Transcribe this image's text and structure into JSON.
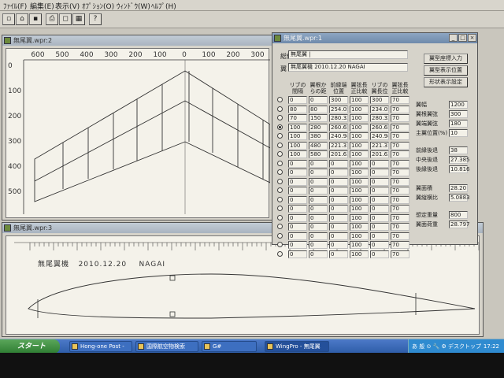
{
  "menu": [
    "ﾌｧｲﾙ(F)",
    "編集(E)",
    "表示(V)",
    "ｵﾌﾟｼｮﾝ(O)",
    "ｳｨﾝﾄﾞｳ(W)",
    "ﾍﾙﾌﾟ(H)"
  ],
  "toolbar_icons": [
    "new-file-icon",
    "open-folder-icon",
    "save-icon",
    "print-icon",
    "view-icon",
    "grid-icon",
    "help-icon"
  ],
  "plan_window": {
    "title": "無尾翼.wpr:2",
    "x_ticks": [
      "600",
      "500",
      "400",
      "300",
      "200",
      "100",
      "0",
      "100",
      "200",
      "300"
    ],
    "y_ticks": [
      "0",
      "100",
      "200",
      "300",
      "400",
      "500"
    ]
  },
  "airfoil_window": {
    "title": "無尾翼.wpr:3",
    "caption": "無尾翼機   2010.12.20    NAGAI"
  },
  "props_window": {
    "title": "無尾翼.wpr:1",
    "body_label": "総体",
    "body_value": "無尾翼 |",
    "wing_label": "翼",
    "wing_value": "無尾翼機  2010.12.20  NAGAI",
    "buttons": [
      "翼型座標入力",
      "翼型表示位置",
      "形状表示設定"
    ],
    "headers": [
      "リブの\n間隔",
      "翼根か\nらの距",
      "前縁端\n位置",
      "翼弦長\n正比較",
      "リブの\n翼長位",
      "翼弦長\n正比較"
    ],
    "rows": [
      [
        "0",
        "0",
        "300",
        "100",
        "300",
        "70"
      ],
      [
        "80",
        "80",
        "254.05",
        "100",
        "234.05",
        "70"
      ],
      [
        "70",
        "150",
        "280.32",
        "100",
        "280.32",
        "70"
      ],
      [
        "100",
        "280",
        "260.65",
        "100",
        "260.65",
        "70"
      ],
      [
        "100",
        "380",
        "240.98",
        "100",
        "240.98",
        "70"
      ],
      [
        "100",
        "480",
        "221.31",
        "100",
        "221.31",
        "70"
      ],
      [
        "100",
        "580",
        "201.63",
        "100",
        "201.63",
        "70"
      ],
      [
        "0",
        "0",
        "0",
        "100",
        "0",
        "70"
      ],
      [
        "0",
        "0",
        "0",
        "100",
        "0",
        "70"
      ],
      [
        "0",
        "0",
        "0",
        "100",
        "0",
        "70"
      ],
      [
        "0",
        "0",
        "0",
        "100",
        "0",
        "70"
      ],
      [
        "0",
        "0",
        "0",
        "100",
        "0",
        "70"
      ],
      [
        "0",
        "0",
        "0",
        "100",
        "0",
        "70"
      ],
      [
        "0",
        "0",
        "0",
        "100",
        "0",
        "70"
      ],
      [
        "0",
        "0",
        "0",
        "100",
        "0",
        "70"
      ],
      [
        "0",
        "0",
        "0",
        "100",
        "0",
        "70"
      ],
      [
        "0",
        "0",
        "0",
        "100",
        "0",
        "70"
      ],
      [
        "0",
        "0",
        "0",
        "100",
        "0",
        "70"
      ]
    ],
    "selected_row": 3,
    "params_a": [
      {
        "label": "翼幅",
        "value": "1200"
      },
      {
        "label": "翼根翼弦",
        "value": "300"
      },
      {
        "label": "翼端翼弦",
        "value": "180"
      },
      {
        "label": "主翼位置(%)",
        "value": "10"
      }
    ],
    "params_b": [
      {
        "label": "前縁後退",
        "value": "38"
      },
      {
        "label": "中央後退",
        "value": "27.385"
      },
      {
        "label": "後縁後退",
        "value": "10.816"
      }
    ],
    "params_c": [
      {
        "label": "翼面積",
        "value": "28.20"
      },
      {
        "label": "翼縦横比",
        "value": "5.0883"
      }
    ],
    "params_d": [
      {
        "label": "想定重量",
        "value": "800"
      },
      {
        "label": "翼面荷重",
        "value": "28.797"
      }
    ]
  },
  "taskbar": {
    "start_label": "スタート",
    "tasks": [
      {
        "label": "Hong-one Post -"
      },
      {
        "label": "国際航空物検索"
      },
      {
        "label": "G#"
      },
      {
        "label": "WingPro - 無尾翼"
      }
    ],
    "tray_text": "あ 般 ⊙ 🔧 ⚙ デスクトップ",
    "clock": "17:22"
  }
}
